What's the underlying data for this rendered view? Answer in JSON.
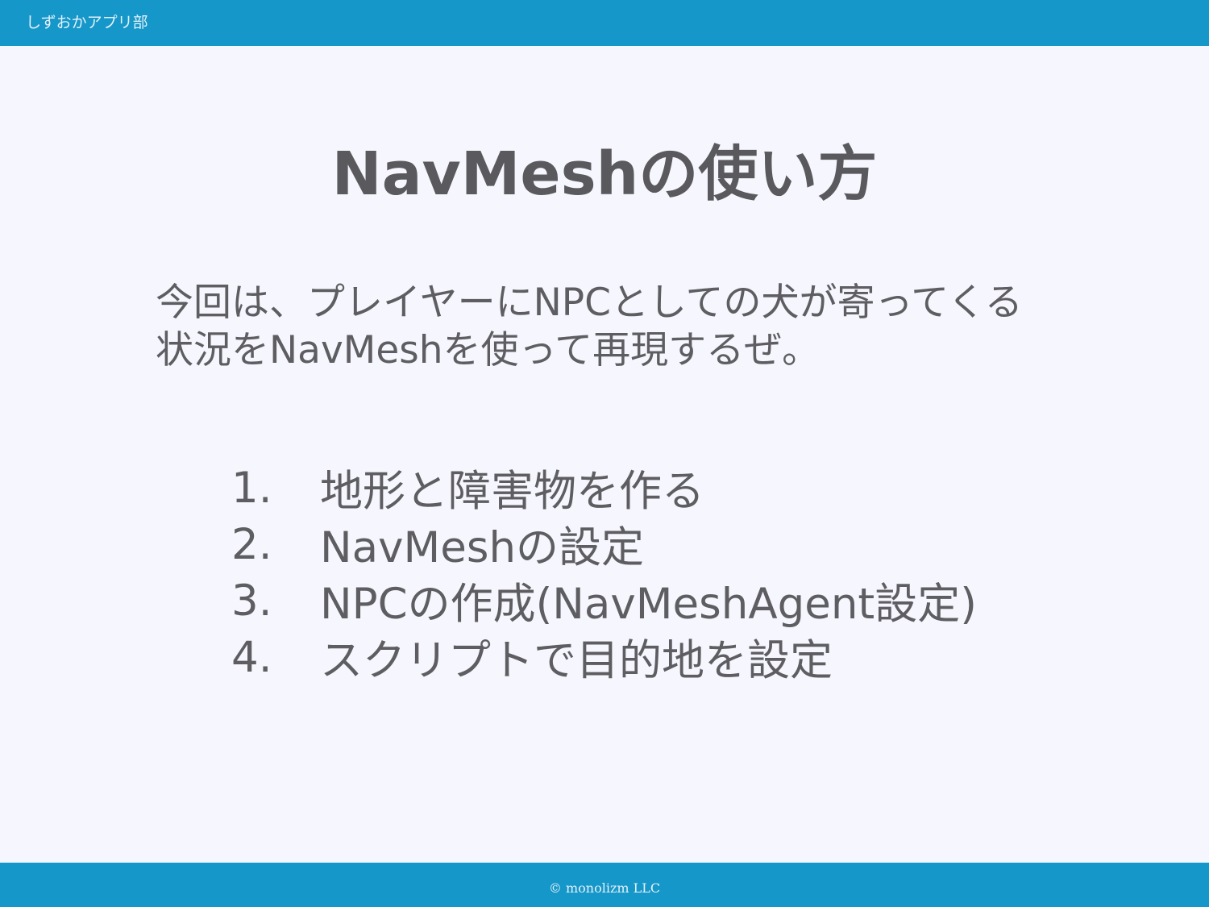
{
  "header": {
    "org": "しずおかアプリ部"
  },
  "slide": {
    "title": "NavMeshの使い方",
    "intro": [
      "今回は、プレイヤーにNPCとしての犬が寄ってくる",
      "状況をNavMeshを使って再現するぜ。"
    ],
    "steps": [
      {
        "num": "1.",
        "text": "地形と障害物を作る"
      },
      {
        "num": "2.",
        "text": "NavMeshの設定"
      },
      {
        "num": "3.",
        "text": "NPCの作成(NavMeshAgent設定)"
      },
      {
        "num": "4.",
        "text": "スクリプトで目的地を設定"
      }
    ]
  },
  "footer": {
    "copyright": "© monolizm LLC"
  },
  "colors": {
    "bar": "#1597c9",
    "background": "#f6f7fe",
    "text": "#5e5e62"
  }
}
